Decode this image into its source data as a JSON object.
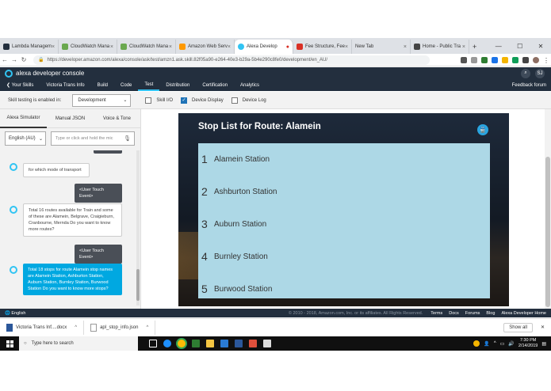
{
  "browser": {
    "tabs": [
      {
        "label": "Lambda Managem",
        "color": "#232f3e",
        "active": false
      },
      {
        "label": "CloudWatch Mana",
        "color": "#6aa84f",
        "active": false
      },
      {
        "label": "CloudWatch Mana",
        "color": "#6aa84f",
        "active": false
      },
      {
        "label": "Amazon Web Serv",
        "color": "#ff9900",
        "active": false
      },
      {
        "label": "Alexa Develop",
        "color": "#31c4f3",
        "active": true
      },
      {
        "label": "Fee Structure, Fee",
        "color": "#d93025",
        "active": false
      },
      {
        "label": "New Tab",
        "color": "#dddddd",
        "active": false
      },
      {
        "label": "Home - Public Tra",
        "color": "#444444",
        "active": false
      }
    ],
    "new_tab": "+",
    "url": "https://developer.amazon.com/alexa/console/ask/test/amzn1.ask.skill.82f05a90-e264-40e3-b29a-5b4e290c8fe0/development/en_AU/",
    "window_controls": [
      "—",
      "☐",
      "✕"
    ]
  },
  "console": {
    "title": "alexa developer console",
    "avatar": "SJ",
    "nav": {
      "back": "❮ Your Skills",
      "skill_name": "Victoria Trans Info",
      "items": [
        "Build",
        "Code",
        "Test",
        "Distribution",
        "Certification",
        "Analytics"
      ],
      "active": "Test",
      "feedback": "Feedback forum"
    }
  },
  "test_row": {
    "label": "Skill testing is enabled in:",
    "stage": "Development",
    "checkboxes": [
      {
        "label": "Skill I/O",
        "checked": false
      },
      {
        "label": "Device Display",
        "checked": true
      },
      {
        "label": "Device Log",
        "checked": false
      }
    ]
  },
  "simulator": {
    "tabs": [
      "Alexa Simulator",
      "Manual JSON",
      "Voice & Tone"
    ],
    "active_tab": "Alexa Simulator",
    "language": "English (AU)",
    "utterance_placeholder": "Type or click and hold the mic",
    "messages": [
      {
        "from": "alexa",
        "text": "for which mode of transport"
      },
      {
        "from": "user",
        "text": "<User Touch Event>"
      },
      {
        "from": "alexa",
        "text": "Total 16 routes available for Train and some of these are Alamein, Belgrave, Craigieburn, Cranbourne, Mernda Do you want to know more routes?"
      },
      {
        "from": "user",
        "text": "<User Touch Event>"
      },
      {
        "from": "alexa-highlight",
        "text": "Total 18 stops for route Alamein stop names are Alamein Station, Ashburton Station, Auburn Station, Burnley Station, Burwood Station Do you want to know more stops?"
      }
    ]
  },
  "device": {
    "title": "Stop List for Route: Alamein",
    "stops": [
      {
        "num": "1",
        "name": "Alamein Station"
      },
      {
        "num": "2",
        "name": "Ashburton Station"
      },
      {
        "num": "3",
        "name": "Auburn Station"
      },
      {
        "num": "4",
        "name": "Burnley Station"
      },
      {
        "num": "5",
        "name": "Burwood Station"
      }
    ]
  },
  "footer": {
    "language": "🌐 English",
    "copyright": "© 2010 - 2018, Amazon.com, Inc. or its affiliates. All Rights Reserved.",
    "links": [
      "Terms",
      "Docs",
      "Forums",
      "Blog",
      "Alexa Developer Home"
    ]
  },
  "downloads": {
    "items": [
      "Victoria Trans Inf....docx",
      "apl_stop_info.json"
    ],
    "show_all": "Show all",
    "close": "✕"
  },
  "taskbar": {
    "search_placeholder": "Type here to search",
    "time": "7:30 PM",
    "date": "2/14/2019"
  }
}
